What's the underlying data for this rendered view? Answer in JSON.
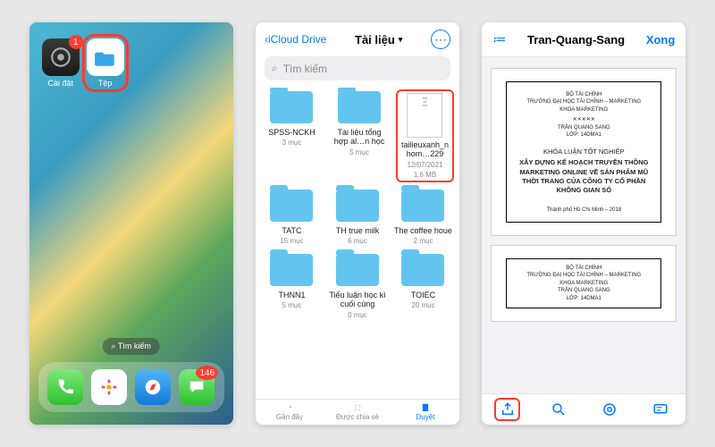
{
  "home": {
    "apps": [
      {
        "label": "Cài đặt",
        "badge": "1"
      },
      {
        "label": "Tệp"
      }
    ],
    "search": "Tìm kiếm",
    "dock_badge": "146"
  },
  "files": {
    "back": "iCloud Drive",
    "title": "Tài liệu",
    "search_placeholder": "Tìm kiếm",
    "items": [
      {
        "name": "SPSS-NCKH",
        "meta": "3 mục"
      },
      {
        "name": "Tài liệu tổng hợp al…n học",
        "meta": "5 mục"
      },
      {
        "name": "tailieuxanh_nhom…229",
        "meta": "12/07/2021",
        "size": "1,6 MB",
        "doc": true
      },
      {
        "name": "TATC",
        "meta": "15 mục"
      },
      {
        "name": "TH true milk",
        "meta": "6 mục"
      },
      {
        "name": "The coffee houe",
        "meta": "2 mục"
      },
      {
        "name": "THNN1",
        "meta": "5 mục"
      },
      {
        "name": "Tiểu luận học kì cuối cùng",
        "meta": "0 mục"
      },
      {
        "name": "TOIEC",
        "meta": "20 mục"
      }
    ],
    "tabs": {
      "recent": "Gần đây",
      "shared": "Được chia sẻ",
      "browse": "Duyệt"
    }
  },
  "viewer": {
    "title": "Tran-Quang-Sang",
    "done": "Xong",
    "page": {
      "ministry": "BỘ TÀI CHÍNH",
      "university": "TRƯỜNG ĐẠI HỌC TÀI CHÍNH – MARKETING",
      "faculty": "KHOA MARKETING",
      "author": "TRẦN QUANG SANG",
      "class": "LỚP: 14DMA1",
      "thesis_label": "KHÓA LUẬN TỐT NGHIỆP",
      "thesis_title": "XÂY DỰNG KẾ HOẠCH TRUYỀN THÔNG MARKETING ONLINE VỀ SẢN PHẨM MŨ THỜI TRANG CỦA CÔNG TY CỔ PHẦN KHÔNG GIAN SỐ",
      "place": "Thành phố Hồ Chí Minh – 2018"
    }
  }
}
